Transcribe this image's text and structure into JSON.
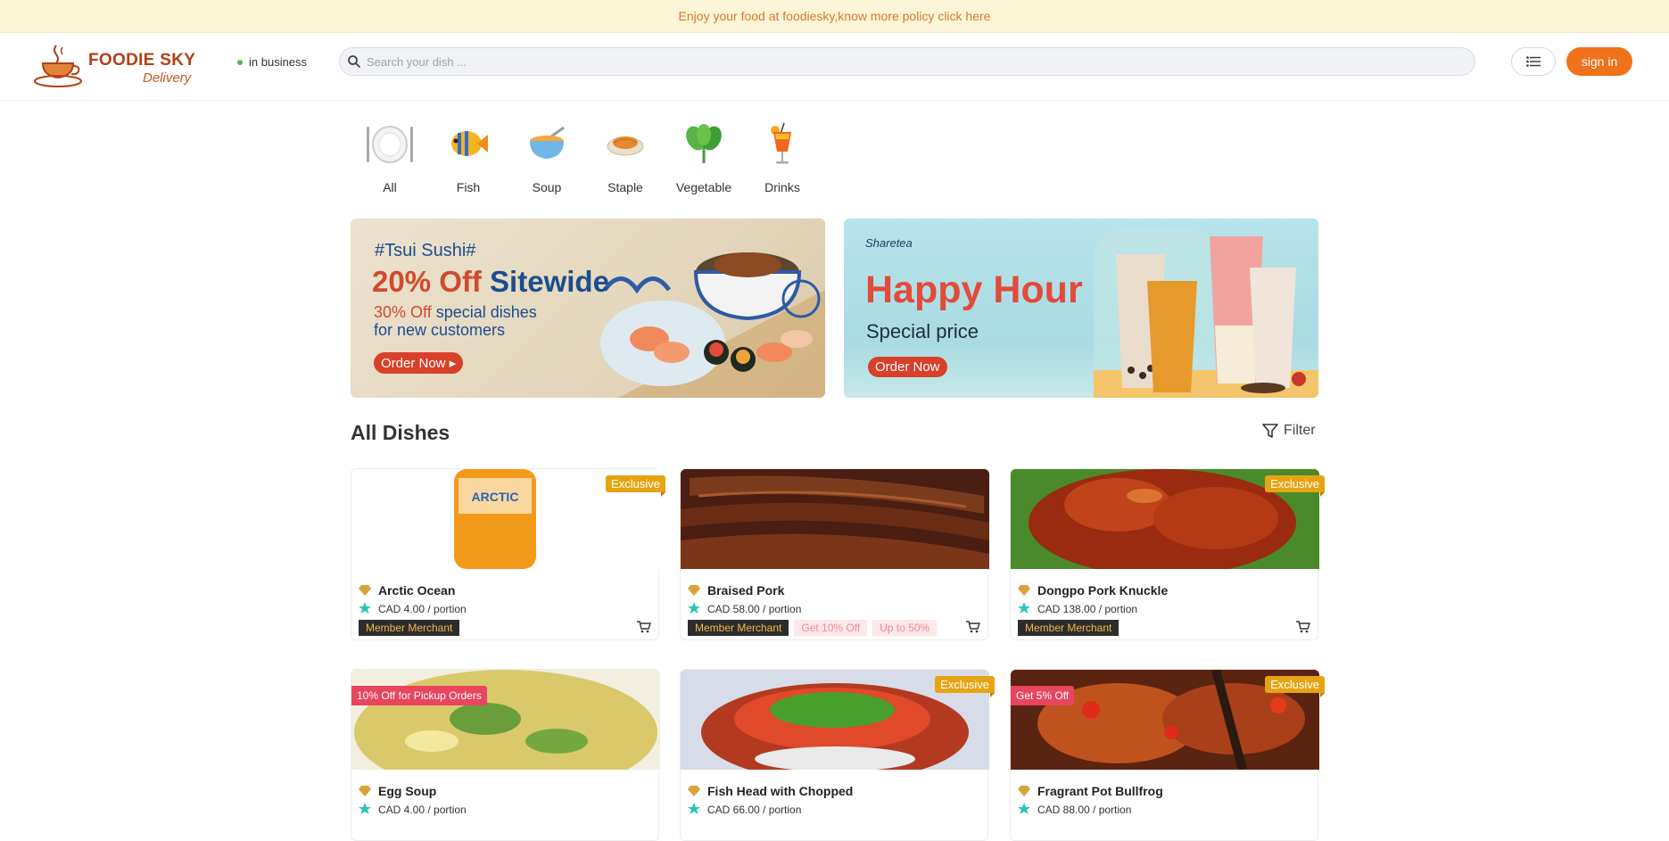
{
  "notice": {
    "text": "Enjoy your food at foodiesky,know more policy click here"
  },
  "header": {
    "logo_title": "FOODIE SKY",
    "logo_subtitle": "Delivery",
    "status": "in business",
    "search_placeholder": "Search your dish ...",
    "signin_label": "sign in"
  },
  "categories": [
    {
      "label": "All",
      "icon": "plate-icon"
    },
    {
      "label": "Fish",
      "icon": "fish-icon"
    },
    {
      "label": "Soup",
      "icon": "soup-icon"
    },
    {
      "label": "Staple",
      "icon": "staple-icon"
    },
    {
      "label": "Vegetable",
      "icon": "vegetable-icon"
    },
    {
      "label": "Drinks",
      "icon": "drink-icon"
    }
  ],
  "banners": {
    "left": {
      "tag": "#Tsui Sushi#",
      "headline_a": "20% Off",
      "headline_b": "Sitewide",
      "sub_a": "30% Off",
      "sub_b": "special dishes",
      "sub_c": "for new customers",
      "cta": "Order Now ▸"
    },
    "right": {
      "brand": "Sharetea",
      "headline": "Happy Hour",
      "sub": "Special price",
      "cta": "Order Now"
    }
  },
  "section": {
    "title": "All Dishes",
    "filter_label": "Filter"
  },
  "dishes": [
    {
      "name": "Arctic Ocean",
      "price": "CAD 4.00 / portion",
      "member_tag": "Member Merchant",
      "badge": "Exclusive",
      "promos": []
    },
    {
      "name": "Braised Pork",
      "price": "CAD 58.00 / portion",
      "member_tag": "Member Merchant",
      "badge": "",
      "promos": [
        "Get 10% Off",
        "Up to 50%"
      ]
    },
    {
      "name": "Dongpo Pork Knuckle",
      "price": "CAD 138.00 / portion",
      "member_tag": "Member Merchant",
      "badge": "Exclusive",
      "promos": []
    },
    {
      "name": "Egg Soup",
      "price": "CAD 4.00 / portion",
      "member_tag": "",
      "badge": "10% Off for Pickup Orders",
      "promos": []
    },
    {
      "name": "Fish Head with Chopped",
      "price": "CAD 66.00 / portion",
      "member_tag": "",
      "badge": "Exclusive",
      "promos": []
    },
    {
      "name": "Fragrant Pot Bullfrog",
      "price": "CAD 88.00 / portion",
      "member_tag": "",
      "badge": "Exclusive",
      "badge2": "Get 5% Off",
      "promos": []
    }
  ],
  "colors": {
    "accent": "#f0721a",
    "notice_bg": "#fdf5d8",
    "exclusive": "#e6a413",
    "promo_pink": "#e8455e"
  }
}
